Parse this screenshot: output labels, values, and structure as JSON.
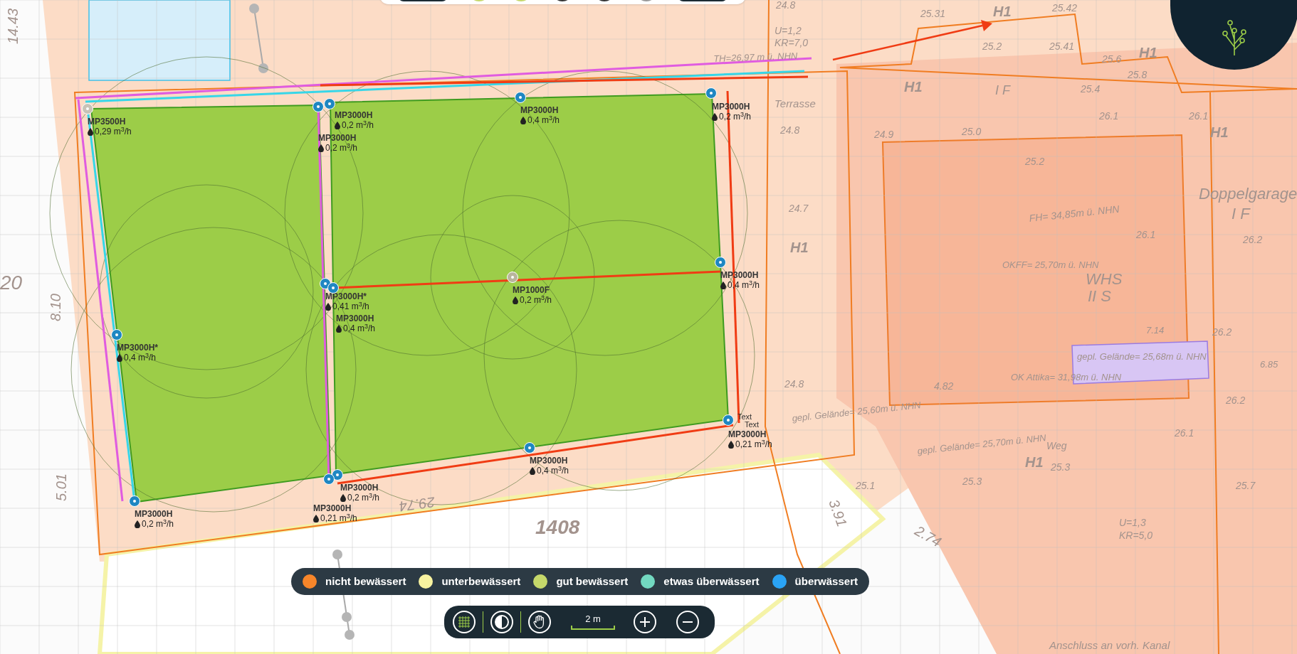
{
  "sprinklers": [
    {
      "model": "MP3500H",
      "flow": "0,29 m$^{3}$/h",
      "color": "#c8c2b6"
    },
    {
      "model": "MP3000H",
      "flow": "0,2 m$^{3}$/h",
      "color": "#1f87c2"
    },
    {
      "model": "MP3000H",
      "flow": "0,4 m$^{3}$/h",
      "color": "#1f87c2"
    },
    {
      "model": "MP3000H",
      "flow": "0,2 m$^{3}$/h",
      "color": "#1f87c2"
    },
    {
      "model": "MP3000H",
      "flow": "0,2 m$^{3}$/h",
      "color": "#1f87c2"
    },
    {
      "model": "MP3000H*",
      "flow": "0,41 m$^{3}$/h",
      "color": "#1f87c2"
    },
    {
      "model": "MP1000F",
      "flow": "0,2 m$^{3}$/h",
      "color": "#b9b59c"
    },
    {
      "model": "MP3000H",
      "flow": "0,4 m$^{3}$/h",
      "color": "#1f87c2"
    },
    {
      "model": "MP3000H",
      "flow": "0,4 m$^{3}$/h",
      "color": "#1f87c2"
    },
    {
      "model": "MP3000H*",
      "flow": "0,4 m$^{3}$/h",
      "color": "#1f87c2"
    },
    {
      "model": "MP3000H",
      "flow": "0,21 m$^{3}$/h",
      "color": "#1f87c2"
    },
    {
      "model": "MP3000H",
      "flow": "0,4 m$^{3}$/h",
      "color": "#1f87c2"
    },
    {
      "model": "MP3000H",
      "flow": "0,2 m$^{3}$/h",
      "color": "#1f87c2"
    },
    {
      "model": "MP3000H",
      "flow": "0,2 m$^{3}$/h",
      "color": "#1f87c2"
    },
    {
      "model": "MP3000H",
      "flow": "0,21 m$^{3}$/h",
      "color": "#1f87c2"
    }
  ],
  "notes": [
    "Text",
    "Text"
  ],
  "plan_labels": [
    "14.43",
    "24.8",
    "25.31",
    "H1",
    "25.42",
    "U=1,2",
    "KR=7,0",
    "25.2",
    "25.41",
    "TH=26,97 m ü. NHN",
    "25.6",
    "H1",
    "25.8",
    "H1",
    "I F",
    "25.4",
    "Terrasse",
    "26.1",
    "26.1",
    "24.8",
    "24.9",
    "25.0",
    "H1",
    "25.2",
    "Doppelgarage",
    "24.7",
    "FH= 34,85m ü. NHN",
    "I F",
    "H1",
    "26.1",
    "26.2",
    "OKFF= 25,70m ü. NHN",
    "20",
    "WHS",
    "II S",
    "8.10",
    "7.14",
    "26.2",
    "gepl. Gelände= 25,68m ü. NHN",
    "6.85",
    "24.8",
    "4.82",
    "OK Attika= 31,98m ü. NHN",
    "26.2",
    "gepl. Gelände= 25,60m ü. NHN",
    "26.1",
    "gepl. Gelände= 25,70m ü. NHN",
    "Weg",
    "H1",
    "25.3",
    "5.01",
    "25.1",
    "25.3",
    "25.7",
    "29.74",
    "1408",
    "3.91",
    "2.74",
    "U=1,3",
    "KR=5,0",
    "Anschluss an vorh. Kanal"
  ],
  "legend": [
    {
      "label": "nicht bewässert",
      "color": "#f7862a"
    },
    {
      "label": "unterbewässert",
      "color": "#f8f3a0"
    },
    {
      "label": "gut bewässert",
      "color": "#c5d86a"
    },
    {
      "label": "etwas überwässert",
      "color": "#72d8c0"
    },
    {
      "label": "überwässert",
      "color": "#2aa3f5"
    }
  ],
  "toolbar": {
    "grid_on": true,
    "scale": "2 m"
  }
}
